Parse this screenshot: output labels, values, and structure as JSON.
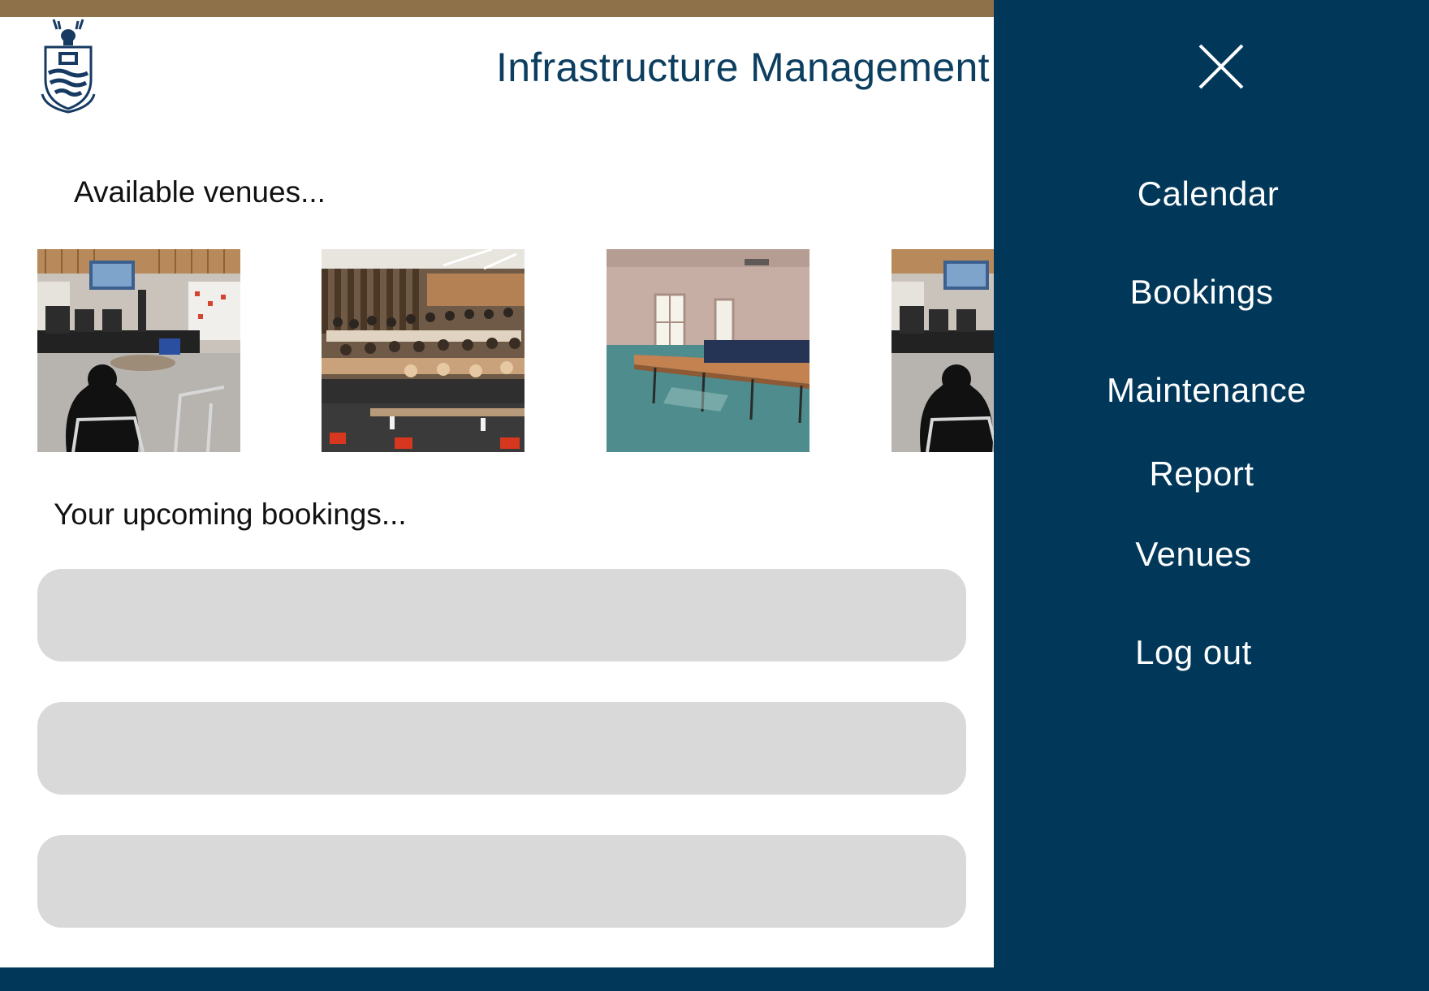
{
  "header": {
    "title": "Infrastructure Management",
    "logo_icon": "university-crest-icon"
  },
  "venues": {
    "heading": "Available venues...",
    "thumbnails": [
      {
        "icon": "venue-atrium-stage-photo"
      },
      {
        "icon": "venue-lecture-theatre-photo"
      },
      {
        "icon": "venue-empty-classroom-photo"
      },
      {
        "icon": "venue-atrium-stage-photo"
      }
    ]
  },
  "bookings": {
    "heading": "Your upcoming bookings...",
    "cards": [
      "",
      "",
      ""
    ]
  },
  "menu": {
    "close_icon": "close-icon",
    "items": [
      {
        "label": "Calendar"
      },
      {
        "label": "Bookings"
      },
      {
        "label": "Maintenance"
      },
      {
        "label": "Report"
      },
      {
        "label": "Venues"
      },
      {
        "label": "Log out"
      }
    ]
  },
  "colors": {
    "brand_navy": "#01385a",
    "accent_gold": "#8f7149",
    "title_text": "#0c3e60",
    "card_grey": "#d9d9d9"
  }
}
